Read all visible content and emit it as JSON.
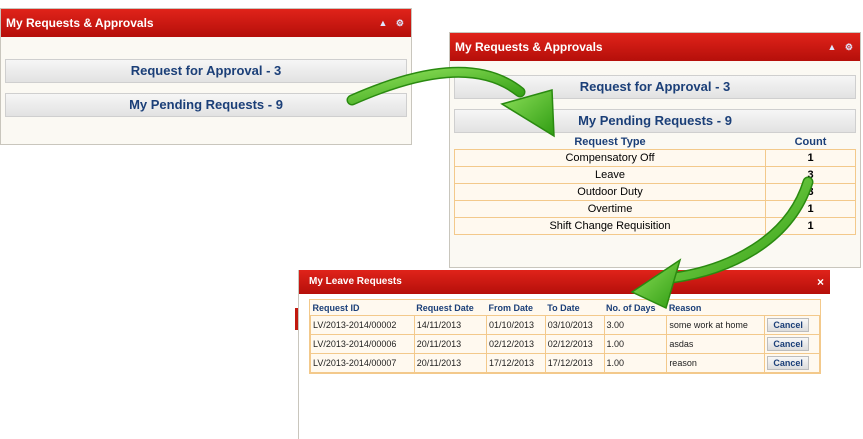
{
  "panel1": {
    "title": "My Requests & Approvals",
    "tool_icons": "▲ ⚙",
    "approval_label": "Request for Approval - 3",
    "pending_label": "My Pending Requests - 9"
  },
  "panel2": {
    "title": "My Requests & Approvals",
    "tool_icons": "▲ ⚙",
    "approval_label": "Request for Approval - 3",
    "pending_label": "My Pending Requests - 9",
    "col_type": "Request Type",
    "col_count": "Count",
    "rows": [
      {
        "type": "Compensatory Off",
        "count": "1"
      },
      {
        "type": "Leave",
        "count": "3"
      },
      {
        "type": "Outdoor Duty",
        "count": "3"
      },
      {
        "type": "Overtime",
        "count": "1"
      },
      {
        "type": "Shift Change Requisition",
        "count": "1"
      }
    ]
  },
  "modal": {
    "title": "My Leave Requests",
    "close": "×",
    "headers": [
      "Request ID",
      "Request Date",
      "From Date",
      "To Date",
      "No. of Days",
      "Reason"
    ],
    "rows": [
      {
        "id": "LV/2013-2014/00002",
        "req": "14/11/2013",
        "from": "01/10/2013",
        "to": "03/10/2013",
        "days": "3.00",
        "reason": "some work at home",
        "action": "Cancel"
      },
      {
        "id": "LV/2013-2014/00006",
        "req": "20/11/2013",
        "from": "02/12/2013",
        "to": "02/12/2013",
        "days": "1.00",
        "reason": "asdas",
        "action": "Cancel"
      },
      {
        "id": "LV/2013-2014/00007",
        "req": "20/11/2013",
        "from": "17/12/2013",
        "to": "17/12/2013",
        "days": "1.00",
        "reason": "reason",
        "action": "Cancel"
      }
    ]
  },
  "colors": {
    "header_red": "#d01a12",
    "label_blue": "#1b3f78",
    "arrow_green": "#3cb31b"
  }
}
